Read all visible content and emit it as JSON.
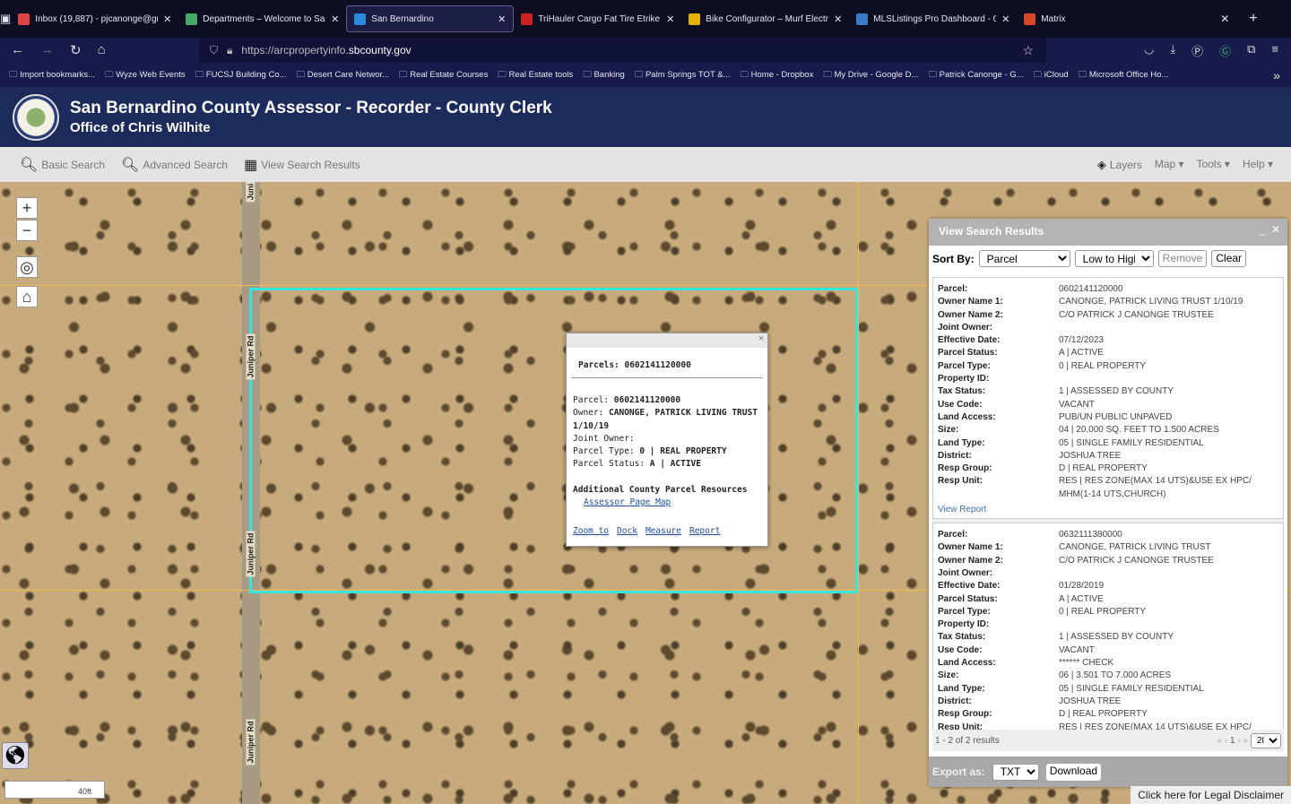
{
  "browser": {
    "tabs": [
      {
        "title": "Inbox (19,887) - pjcanonge@gm",
        "color": "#d44"
      },
      {
        "title": "Departments – Welcome to San",
        "color": "#4a6"
      },
      {
        "title": "San Bernardino",
        "color": "#2a8ad8",
        "active": true
      },
      {
        "title": "TriHauler Cargo Fat Tire Etrike (",
        "color": "#c22"
      },
      {
        "title": "Bike Configurator – Murf Electri",
        "color": "#e2b400"
      },
      {
        "title": "MLSListings Pro Dashboard - 0",
        "color": "#3a7bc8"
      },
      {
        "title": "Matrix",
        "color": "#d5482a"
      }
    ],
    "url_prefix": "https://arcpropertyinfo.",
    "url_domain": "sbcounty.gov",
    "bookmarks": [
      "Import bookmarks...",
      "Wyze Web Events",
      "FUCSJ Building Co...",
      "Desert Care Networ...",
      "Real Estate Courses",
      "Real Estate tools",
      "Banking",
      "Palm Springs TOT &...",
      "Home - Dropbox",
      "My Drive - Google D...",
      "Patrick Canonge - G...",
      "iCloud",
      "Microsoft Office Ho..."
    ]
  },
  "header": {
    "title": "San Bernardino County Assessor - Recorder - County Clerk",
    "subtitle": "Office of Chris Wilhite"
  },
  "toolbar": {
    "basic": "Basic Search",
    "advanced": "Advanced Search",
    "view": "View Search Results",
    "layers": "Layers",
    "map": "Map",
    "tools": "Tools",
    "help": "Help"
  },
  "map": {
    "road_labels": [
      "Juniper Rd",
      "Juniper Rd",
      "Juniper Rd",
      "Juni"
    ],
    "scale": "40ft",
    "accent": "#37e4e0"
  },
  "popup": {
    "title": "Parcels: 0602141120000",
    "parcel_label": "Parcel: ",
    "parcel": "0602141120000",
    "owner_label": "Owner: ",
    "owner": "CANONGE, PATRICK LIVING TRUST 1/10/19",
    "joint_label": "Joint Owner:",
    "type_label": "Parcel Type: ",
    "type": "0 | REAL PROPERTY",
    "status_label": "Parcel Status: ",
    "status": "A | ACTIVE",
    "resources": "Additional County Parcel Resources",
    "assessor_link": "Assessor Page Map",
    "actions": [
      "Zoom to",
      "Dock",
      "Measure",
      "Report"
    ]
  },
  "panel": {
    "title": "View Search Results",
    "sort_label": "Sort By:",
    "sort_field": "Parcel",
    "sort_order": "Low to High",
    "remove": "Remove",
    "clear": "Clear",
    "records": [
      {
        "rows": [
          [
            "Parcel:",
            "0602141120000"
          ],
          [
            "Owner Name 1:",
            "CANONGE, PATRICK LIVING TRUST 1/10/19"
          ],
          [
            "Owner Name 2:",
            "C/O PATRICK J CANONGE TRUSTEE"
          ],
          [
            "Joint Owner:",
            ""
          ],
          [
            "Effective Date:",
            "07/12/2023"
          ],
          [
            "Parcel Status:",
            "A | ACTIVE"
          ],
          [
            "Parcel Type:",
            "0 | REAL PROPERTY"
          ],
          [
            "Property ID:",
            ""
          ],
          [
            "Tax Status:",
            "1 | ASSESSED BY COUNTY"
          ],
          [
            "Use Code:",
            "VACANT"
          ],
          [
            "Land Access:",
            "PUB/UN PUBLIC UNPAVED"
          ],
          [
            "Size:",
            "04 | 20,000 SQ. FEET TO 1.500 ACRES"
          ],
          [
            "Land Type:",
            "05 | SINGLE FAMILY RESIDENTIAL"
          ],
          [
            "District:",
            "JOSHUA TREE"
          ],
          [
            "Resp Group:",
            "D | REAL PROPERTY"
          ],
          [
            "Resp Unit:",
            "RES | RES ZONE(MAX 14 UTS)&USE EX HPC/ MHM(1-14 UTS,CHURCH)"
          ]
        ],
        "link": "View Report"
      },
      {
        "rows": [
          [
            "Parcel:",
            "0632111380000"
          ],
          [
            "Owner Name 1:",
            "CANONGE, PATRICK LIVING TRUST"
          ],
          [
            "Owner Name 2:",
            "C/O PATRICK J CANONGE TRUSTEE"
          ],
          [
            "Joint Owner:",
            ""
          ],
          [
            "Effective Date:",
            "01/28/2019"
          ],
          [
            "Parcel Status:",
            "A | ACTIVE"
          ],
          [
            "Parcel Type:",
            "0 | REAL PROPERTY"
          ],
          [
            "Property ID:",
            ""
          ],
          [
            "Tax Status:",
            "1 | ASSESSED BY COUNTY"
          ],
          [
            "Use Code:",
            "VACANT"
          ],
          [
            "Land Access:",
            "****** CHECK"
          ],
          [
            "Size:",
            "06 | 3.501 TO 7.000 ACRES"
          ],
          [
            "Land Type:",
            "05 | SINGLE FAMILY RESIDENTIAL"
          ],
          [
            "District:",
            "JOSHUA TREE"
          ],
          [
            "Resp Group:",
            "D | REAL PROPERTY"
          ],
          [
            "Resp Unit:",
            "RES | RES ZONE(MAX 14 UTS)&USE EX HPC/"
          ]
        ]
      }
    ],
    "results": "1 - 2 of 2 results",
    "page": "1",
    "page_size": "20",
    "export_label": "Export as:",
    "export_format": "TXT",
    "download": "Download"
  },
  "disclaimer": "Click here for Legal Disclaimer"
}
